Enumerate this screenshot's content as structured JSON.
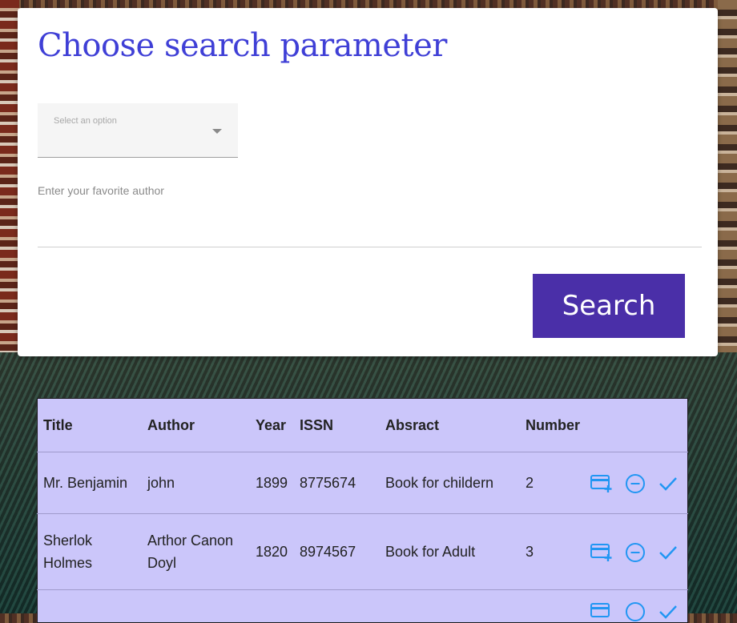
{
  "search": {
    "title": "Choose search parameter",
    "select_placeholder": "Select an option",
    "author_label": "Enter your favorite author",
    "author_value": "",
    "button_label": "Search"
  },
  "table": {
    "columns": [
      "Title",
      "Author",
      "Year",
      "ISSN",
      "Absract",
      "Number"
    ],
    "rows": [
      {
        "title": "Mr. Benjamin",
        "author": "john",
        "year": "1899",
        "issn": "8775674",
        "abstract": "Book for childern",
        "number": "2"
      },
      {
        "title": "Sherlok Holmes",
        "author": "Arthor Canon Doyl",
        "year": "1820",
        "issn": "8974567",
        "abstract": "Book for Adult",
        "number": "3"
      },
      {
        "title": "",
        "author": "",
        "year": "",
        "issn": "",
        "abstract": "",
        "number": ""
      }
    ],
    "row_actions": [
      "add-card-icon",
      "remove-circle-icon",
      "check-icon"
    ]
  },
  "colors": {
    "title": "#3f3fd6",
    "button": "#4a2fa8",
    "table_bg": "#cbc6fa",
    "icon": "#2196f3"
  }
}
